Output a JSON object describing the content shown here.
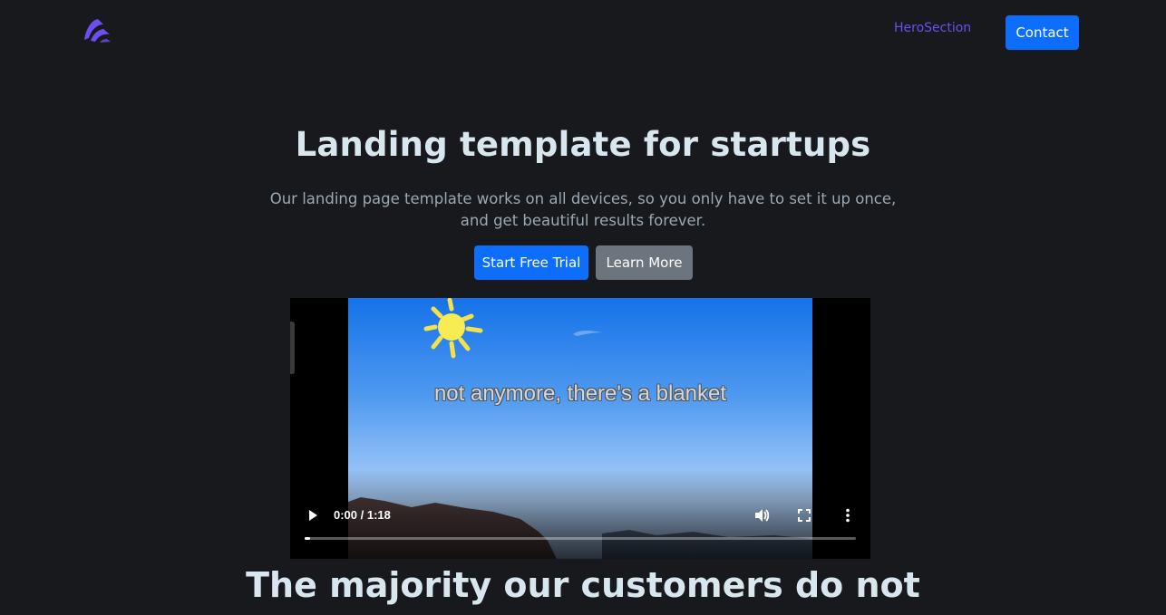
{
  "header": {
    "logo_icon": "brand-logo-icon",
    "nav_link": "HeroSection",
    "contact_label": "Contact"
  },
  "hero": {
    "title": "Landing template for startups",
    "subtitle_line1": "Our landing page template works on all devices, so you only have to set it up once,",
    "subtitle_line2": "and get beautiful results forever.",
    "primary_label": "Start Free Trial",
    "secondary_label": "Learn More"
  },
  "video": {
    "caption": "not anymore, there's a blanket",
    "time": "0:00 / 1:18",
    "progress": 0.01,
    "icons": [
      "play-icon",
      "volume-icon",
      "fullscreen-icon",
      "more-options-icon"
    ]
  },
  "section": {
    "title": "The majority our customers do not"
  },
  "colors": {
    "background": "#18191c",
    "primary": "#0d6efd",
    "secondary": "#6c757d",
    "nav_link": "#6d4ef0",
    "heading": "#d8e6ee",
    "body_text": "#9aa8b4"
  }
}
